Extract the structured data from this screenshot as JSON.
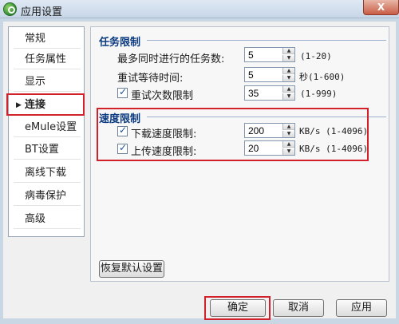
{
  "window": {
    "title": "应用设置",
    "close_label": "X"
  },
  "sidebar": {
    "items": [
      {
        "label": "常规"
      },
      {
        "label": "任务属性"
      },
      {
        "label": "显示"
      },
      {
        "label": "连接",
        "active": true
      },
      {
        "label": "eMule设置"
      },
      {
        "label": "BT设置"
      },
      {
        "label": "离线下载"
      },
      {
        "label": "病毒保护"
      },
      {
        "label": "高级"
      }
    ]
  },
  "task_limit": {
    "title": "任务限制",
    "max_tasks": {
      "label": "最多同时进行的任务数:",
      "value": "5",
      "range": "(1-20)"
    },
    "retry_wait": {
      "label": "重试等待时间:",
      "value": "5",
      "unit_range": "秒(1-600)"
    },
    "retry_count": {
      "label": "重试次数限制",
      "checked": true,
      "value": "35",
      "range": "(1-999)"
    }
  },
  "speed_limit": {
    "title": "速度限制",
    "download": {
      "label": "下载速度限制:",
      "checked": true,
      "value": "200",
      "unit_range": "KB/s (1-4096)"
    },
    "upload": {
      "label": "上传速度限制:",
      "checked": true,
      "value": "20",
      "unit_range": "KB/s (1-4096)"
    }
  },
  "buttons": {
    "restore_defaults": "恢复默认设置",
    "ok": "确定",
    "cancel": "取消",
    "apply": "应用"
  },
  "colors": {
    "highlight": "#d3212b",
    "section_title": "#0b3b80"
  }
}
